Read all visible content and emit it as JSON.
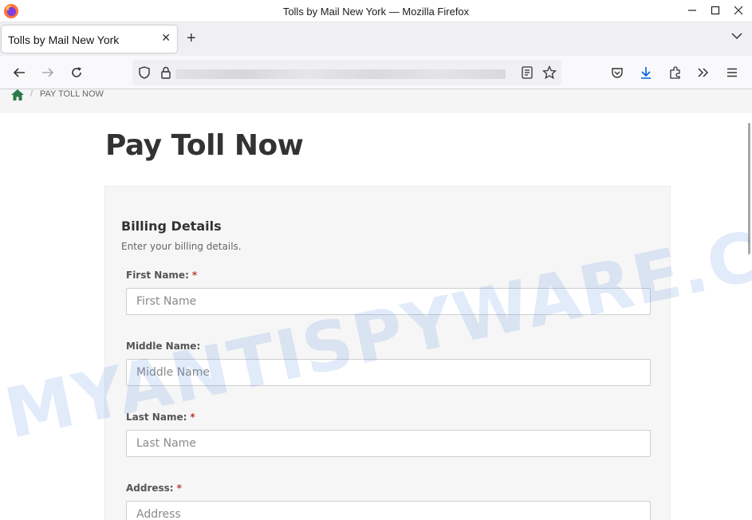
{
  "window": {
    "title": "Tolls by Mail New York — Mozilla Firefox"
  },
  "tab": {
    "title": "Tolls by Mail New York",
    "close": "✕",
    "new_tab": "+"
  },
  "breadcrumb": {
    "current": "PAY TOLL NOW",
    "separator": "/"
  },
  "page": {
    "title": "Pay Toll Now"
  },
  "billing": {
    "heading": "Billing Details",
    "subtitle": "Enter your billing details.",
    "required_mark": "*",
    "fields": [
      {
        "label": "First Name:",
        "placeholder": "First Name",
        "required": true
      },
      {
        "label": "Middle Name:",
        "placeholder": "Middle Name",
        "required": false
      },
      {
        "label": "Last Name:",
        "placeholder": "Last Name",
        "required": true
      },
      {
        "label": "Address:",
        "placeholder": "Address",
        "required": true
      }
    ]
  },
  "watermark": "MYANTISPYWARE.COM",
  "colors": {
    "home_icon": "#2b7a4b",
    "download_icon": "#0061e0",
    "required": "#c0392b"
  }
}
